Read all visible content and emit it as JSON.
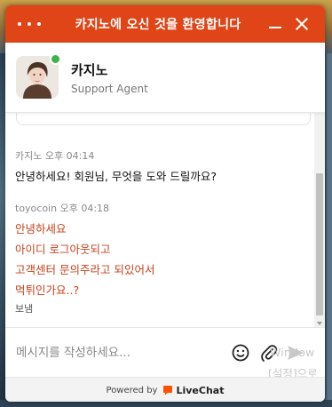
{
  "window": {
    "title": "카지노에 오신 것을 환영합니다"
  },
  "agent": {
    "name": "카지노",
    "role": "Support Agent",
    "status_color": "#3bb34a"
  },
  "messages": {
    "agent_message": {
      "author": "카지노",
      "time": "오후 04:14",
      "text": "안녕하세요! 회원님, 무엇을 도와 드릴까요?"
    },
    "user_message": {
      "author": "toyocoin",
      "time": "오후 04:18",
      "lines": [
        "안녕하세요",
        "아이디 로그아웃되고",
        "고객센터 문의주라고 되있어서",
        "먹튀인가요..?"
      ],
      "status": "보냄"
    }
  },
  "composer": {
    "placeholder": "메시지를 작성하세요...",
    "emoji_icon": "emoji-icon",
    "attach_icon": "paperclip-icon",
    "send_icon": "send-arrow-icon"
  },
  "os_watermark": {
    "line1": "Window",
    "line2": "[설정]으로"
  },
  "footer": {
    "powered_by": "Powered by",
    "brand": "LiveChat",
    "brand_color": "#ff5100"
  },
  "colors": {
    "accent": "#df4516",
    "user_text": "#c8401a"
  }
}
